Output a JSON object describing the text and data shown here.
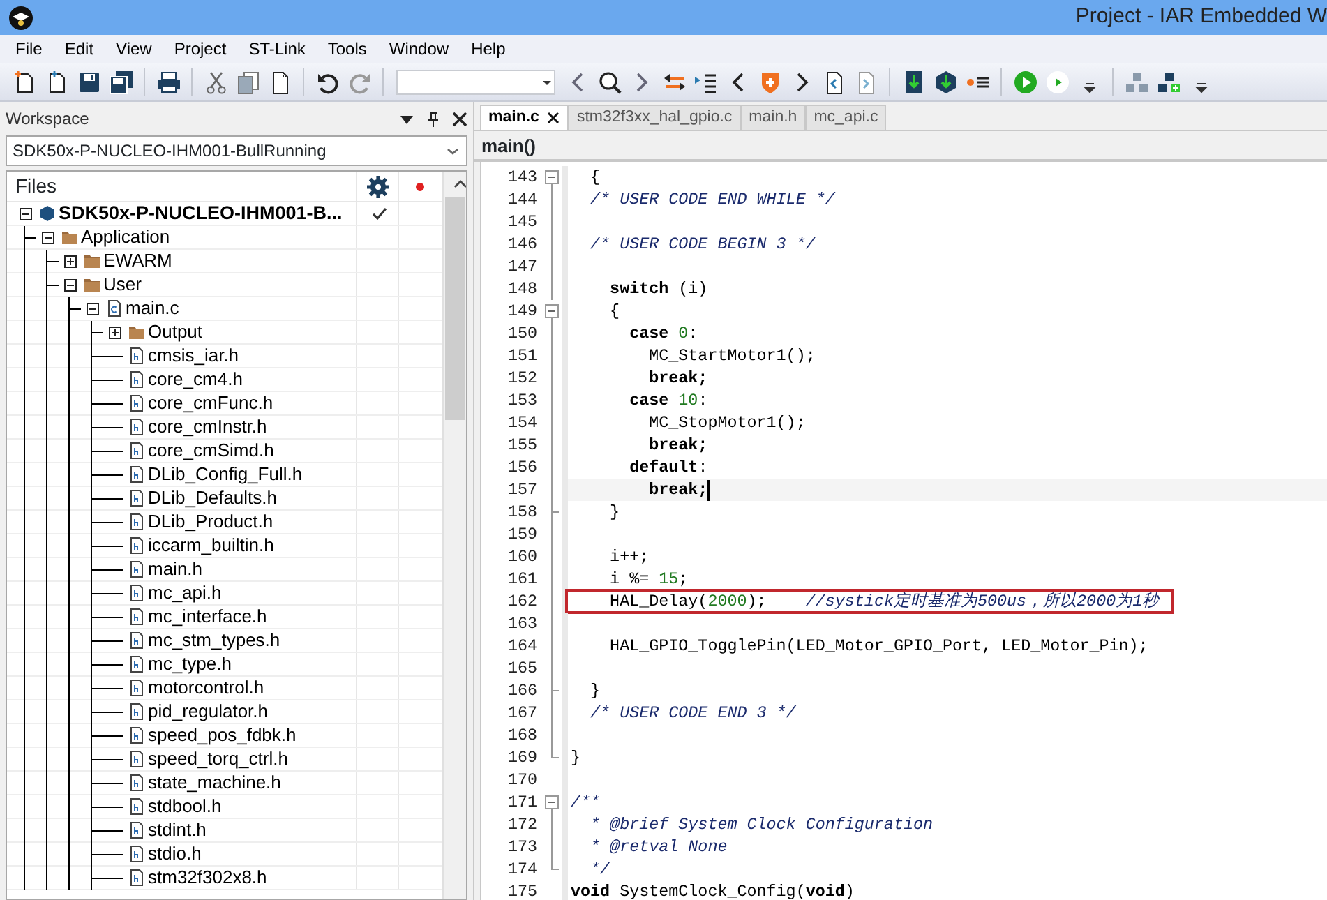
{
  "window": {
    "title": "Project - IAR Embedded W"
  },
  "menu": [
    "File",
    "Edit",
    "View",
    "Project",
    "ST-Link",
    "Tools",
    "Window",
    "Help"
  ],
  "workspace": {
    "title": "Workspace",
    "configuration": "SDK50x-P-NUCLEO-IHM001-BullRunning",
    "column": "Files",
    "tree": [
      {
        "label": "SDK50x-P-NUCLEO-IHM001-B...",
        "kind": "project",
        "expanded": true,
        "active": true,
        "children": [
          {
            "label": "Application",
            "kind": "folder",
            "expanded": true,
            "children": [
              {
                "label": "EWARM",
                "kind": "folder",
                "expanded": false
              },
              {
                "label": "User",
                "kind": "folder",
                "expanded": true,
                "children": [
                  {
                    "label": "main.c",
                    "kind": "c-file",
                    "expanded": true,
                    "children": [
                      {
                        "label": "Output",
                        "kind": "folder",
                        "expanded": false
                      },
                      {
                        "label": "cmsis_iar.h",
                        "kind": "h-file"
                      },
                      {
                        "label": "core_cm4.h",
                        "kind": "h-file"
                      },
                      {
                        "label": "core_cmFunc.h",
                        "kind": "h-file"
                      },
                      {
                        "label": "core_cmInstr.h",
                        "kind": "h-file"
                      },
                      {
                        "label": "core_cmSimd.h",
                        "kind": "h-file"
                      },
                      {
                        "label": "DLib_Config_Full.h",
                        "kind": "h-file"
                      },
                      {
                        "label": "DLib_Defaults.h",
                        "kind": "h-file"
                      },
                      {
                        "label": "DLib_Product.h",
                        "kind": "h-file"
                      },
                      {
                        "label": "iccarm_builtin.h",
                        "kind": "h-file"
                      },
                      {
                        "label": "main.h",
                        "kind": "h-file"
                      },
                      {
                        "label": "mc_api.h",
                        "kind": "h-file"
                      },
                      {
                        "label": "mc_interface.h",
                        "kind": "h-file"
                      },
                      {
                        "label": "mc_stm_types.h",
                        "kind": "h-file"
                      },
                      {
                        "label": "mc_type.h",
                        "kind": "h-file"
                      },
                      {
                        "label": "motorcontrol.h",
                        "kind": "h-file"
                      },
                      {
                        "label": "pid_regulator.h",
                        "kind": "h-file"
                      },
                      {
                        "label": "speed_pos_fdbk.h",
                        "kind": "h-file"
                      },
                      {
                        "label": "speed_torq_ctrl.h",
                        "kind": "h-file"
                      },
                      {
                        "label": "state_machine.h",
                        "kind": "h-file"
                      },
                      {
                        "label": "stdbool.h",
                        "kind": "h-file"
                      },
                      {
                        "label": "stdint.h",
                        "kind": "h-file"
                      },
                      {
                        "label": "stdio.h",
                        "kind": "h-file"
                      },
                      {
                        "label": "stm32f302x8.h",
                        "kind": "h-file"
                      }
                    ]
                  }
                ]
              }
            ]
          }
        ]
      }
    ]
  },
  "editor": {
    "tabs": [
      {
        "label": "main.c",
        "selected": true
      },
      {
        "label": "stm32f3xx_hal_gpio.c",
        "selected": false
      },
      {
        "label": "main.h",
        "selected": false
      },
      {
        "label": "mc_api.c",
        "selected": false
      }
    ],
    "function": "main()",
    "lines": [
      {
        "number": "143",
        "fold_start": true,
        "tokens": [
          {
            "kind": "p",
            "text": "  {"
          }
        ]
      },
      {
        "number": "144",
        "tokens": [
          {
            "kind": "c",
            "text": "  /* USER CODE END WHILE */"
          }
        ]
      },
      {
        "number": "145"
      },
      {
        "number": "146",
        "tokens": [
          {
            "kind": "c",
            "text": "  /* USER CODE BEGIN 3 */"
          }
        ]
      },
      {
        "number": "147"
      },
      {
        "number": "148",
        "tokens": [
          {
            "kind": "k",
            "text": "    switch"
          },
          {
            "kind": "p",
            "text": " (i)"
          }
        ]
      },
      {
        "number": "149",
        "fold_start": true,
        "tokens": [
          {
            "kind": "p",
            "text": "    {"
          }
        ]
      },
      {
        "number": "150",
        "tokens": [
          {
            "kind": "k",
            "text": "      case "
          },
          {
            "kind": "n",
            "text": "0"
          },
          {
            "kind": "p",
            "text": ":"
          }
        ]
      },
      {
        "number": "151",
        "tokens": [
          {
            "kind": "p",
            "text": "        MC_StartMotor1();"
          }
        ]
      },
      {
        "number": "152",
        "tokens": [
          {
            "kind": "k",
            "text": "        break;"
          }
        ]
      },
      {
        "number": "153",
        "tokens": [
          {
            "kind": "k",
            "text": "      case "
          },
          {
            "kind": "n",
            "text": "10"
          },
          {
            "kind": "p",
            "text": ":"
          }
        ]
      },
      {
        "number": "154",
        "tokens": [
          {
            "kind": "p",
            "text": "        MC_StopMotor1();"
          }
        ]
      },
      {
        "number": "155",
        "tokens": [
          {
            "kind": "k",
            "text": "        break;"
          }
        ]
      },
      {
        "number": "156",
        "tokens": [
          {
            "kind": "k",
            "text": "      default"
          },
          {
            "kind": "p",
            "text": ":"
          }
        ]
      },
      {
        "number": "157",
        "current": true,
        "tokens": [
          {
            "kind": "k",
            "text": "        break;"
          }
        ]
      },
      {
        "number": "158",
        "fold_end": true,
        "tokens": [
          {
            "kind": "p",
            "text": "    }"
          }
        ]
      },
      {
        "number": "159"
      },
      {
        "number": "160",
        "tokens": [
          {
            "kind": "p",
            "text": "    i++;"
          }
        ]
      },
      {
        "number": "161",
        "tokens": [
          {
            "kind": "p",
            "text": "    i %= "
          },
          {
            "kind": "n",
            "text": "15"
          },
          {
            "kind": "p",
            "text": ";"
          }
        ]
      },
      {
        "number": "162",
        "boxed": true,
        "tokens": [
          {
            "kind": "p",
            "text": "    HAL_Delay("
          },
          {
            "kind": "n",
            "text": "2000"
          },
          {
            "kind": "p",
            "text": ");"
          },
          {
            "kind": "c",
            "text": "    //systick定时基准为500us，所以2000为1秒"
          }
        ]
      },
      {
        "number": "163"
      },
      {
        "number": "164",
        "tokens": [
          {
            "kind": "p",
            "text": "    HAL_GPIO_TogglePin(LED_Motor_GPIO_Port, LED_Motor_Pin);"
          }
        ]
      },
      {
        "number": "165"
      },
      {
        "number": "166",
        "fold_end": true,
        "tokens": [
          {
            "kind": "p",
            "text": "  }"
          }
        ]
      },
      {
        "number": "167",
        "tokens": [
          {
            "kind": "c",
            "text": "  /* USER CODE END 3 */"
          }
        ]
      },
      {
        "number": "168"
      },
      {
        "number": "169",
        "fold_end": true,
        "tokens": [
          {
            "kind": "p",
            "text": "}"
          }
        ]
      },
      {
        "number": "170"
      },
      {
        "number": "171",
        "fold_start": true,
        "tokens": [
          {
            "kind": "c",
            "text": "/**"
          }
        ]
      },
      {
        "number": "172",
        "tokens": [
          {
            "kind": "c",
            "text": "  * @brief System Clock Configuration"
          }
        ]
      },
      {
        "number": "173",
        "tokens": [
          {
            "kind": "c",
            "text": "  * @retval None"
          }
        ]
      },
      {
        "number": "174",
        "fold_end": true,
        "tokens": [
          {
            "kind": "c",
            "text": "  */"
          }
        ]
      },
      {
        "number": "175",
        "tokens": [
          {
            "kind": "k",
            "text": "void"
          },
          {
            "kind": "p",
            "text": " SystemClock_Config("
          },
          {
            "kind": "k",
            "text": "void"
          },
          {
            "kind": "p",
            "text": ")"
          }
        ]
      }
    ]
  }
}
